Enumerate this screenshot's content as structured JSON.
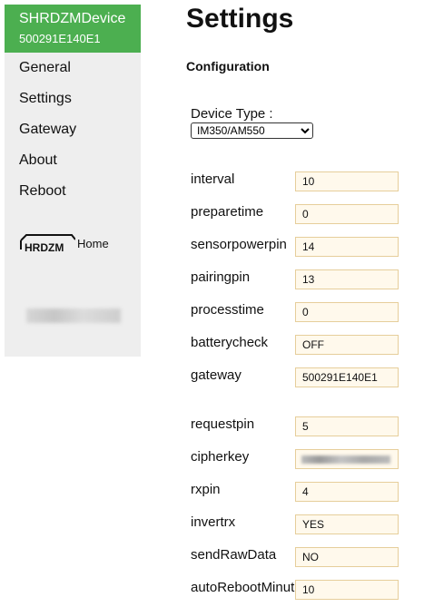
{
  "sidebar": {
    "device_name": "SHRDZMDevice",
    "device_id": "500291E140E1",
    "accent_color": "#4caf50",
    "nav": [
      {
        "label": "General"
      },
      {
        "label": "Settings"
      },
      {
        "label": "Gateway"
      },
      {
        "label": "About"
      },
      {
        "label": "Reboot"
      }
    ],
    "home": {
      "label": "Home",
      "logo_text": "HRDZM"
    }
  },
  "main": {
    "title": "Settings",
    "section": "Configuration",
    "device_type": {
      "label": "Device Type :",
      "value": "IM350/AM550"
    },
    "fields": [
      {
        "label": "interval",
        "value": "10"
      },
      {
        "label": "preparetime",
        "value": "0"
      },
      {
        "label": "sensorpowerpin",
        "value": "14"
      },
      {
        "label": "pairingpin",
        "value": "13"
      },
      {
        "label": "processtime",
        "value": "0"
      },
      {
        "label": "batterycheck",
        "value": "OFF"
      },
      {
        "label": "gateway",
        "value": "500291E140E1"
      },
      {
        "label": "requestpin",
        "value": "5"
      },
      {
        "label": "cipherkey",
        "value": ""
      },
      {
        "label": "rxpin",
        "value": "4"
      },
      {
        "label": "invertrx",
        "value": "YES"
      },
      {
        "label": "sendRawData",
        "value": "NO"
      },
      {
        "label": "autoRebootMinutes",
        "value": "10"
      }
    ]
  }
}
